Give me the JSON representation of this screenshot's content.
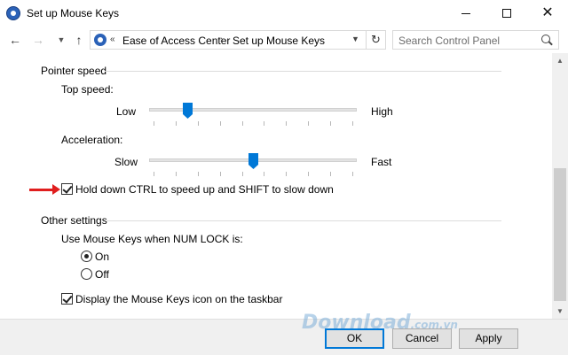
{
  "window": {
    "title": "Set up Mouse Keys"
  },
  "nav": {
    "breadcrumb_root": "Ease of Access Center",
    "breadcrumb_current": "Set up Mouse Keys",
    "search_placeholder": "Search Control Panel"
  },
  "pointer_speed": {
    "group_title": "Pointer speed",
    "top_speed": {
      "label": "Top speed:",
      "min_label": "Low",
      "max_label": "High",
      "level": 0.17
    },
    "acceleration": {
      "label": "Acceleration:",
      "min_label": "Slow",
      "max_label": "Fast",
      "level": 0.5
    },
    "ctrl_shift_checkbox": {
      "label": "Hold down CTRL to speed up and SHIFT to slow down",
      "checked": true
    }
  },
  "other_settings": {
    "group_title": "Other settings",
    "numlock_label": "Use Mouse Keys when NUM LOCK is:",
    "option_on": "On",
    "option_off": "Off",
    "selected": "On",
    "taskbar_checkbox": {
      "label": "Display the Mouse Keys icon on the taskbar",
      "checked": true
    }
  },
  "buttons": {
    "ok": "OK",
    "cancel": "Cancel",
    "apply": "Apply"
  },
  "watermark": {
    "main": "Download",
    "suffix": ".com.vn"
  },
  "colors": {
    "accent": "#0078d7",
    "arrow": "#e01e1e"
  }
}
